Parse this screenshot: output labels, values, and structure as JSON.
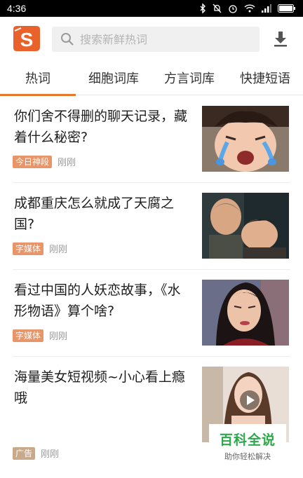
{
  "status_bar": {
    "time": "4:36"
  },
  "search": {
    "placeholder": "搜索新鲜热词"
  },
  "tabs": [
    {
      "label": "热词",
      "active": true
    },
    {
      "label": "细胞词库",
      "active": false
    },
    {
      "label": "方言词库",
      "active": false
    },
    {
      "label": "快捷短语",
      "active": false
    }
  ],
  "feed": [
    {
      "title": "你们舍不得删的聊天记录，藏着什么秘密?",
      "tag": "今日神段",
      "tag_color": "#e8956a",
      "time": "刚刚"
    },
    {
      "title": "成都重庆怎么就成了天腐之国?",
      "tag": "字媒体",
      "tag_color": "#e8956a",
      "time": "刚刚"
    },
    {
      "title": "看过中国的人妖恋故事，《水形物语》算个啥?",
      "tag": "字媒体",
      "tag_color": "#e8956a",
      "time": "刚刚"
    },
    {
      "title": "海量美女短视频~小心看上瘾哦",
      "tag": "广告",
      "tag_color": "#c9a98c",
      "time": "刚刚"
    }
  ],
  "watermark": {
    "title": "百科全说",
    "subtitle": "助你轻松解决"
  },
  "colors": {
    "accent": "#e8772e",
    "logo": "#e9622c"
  }
}
